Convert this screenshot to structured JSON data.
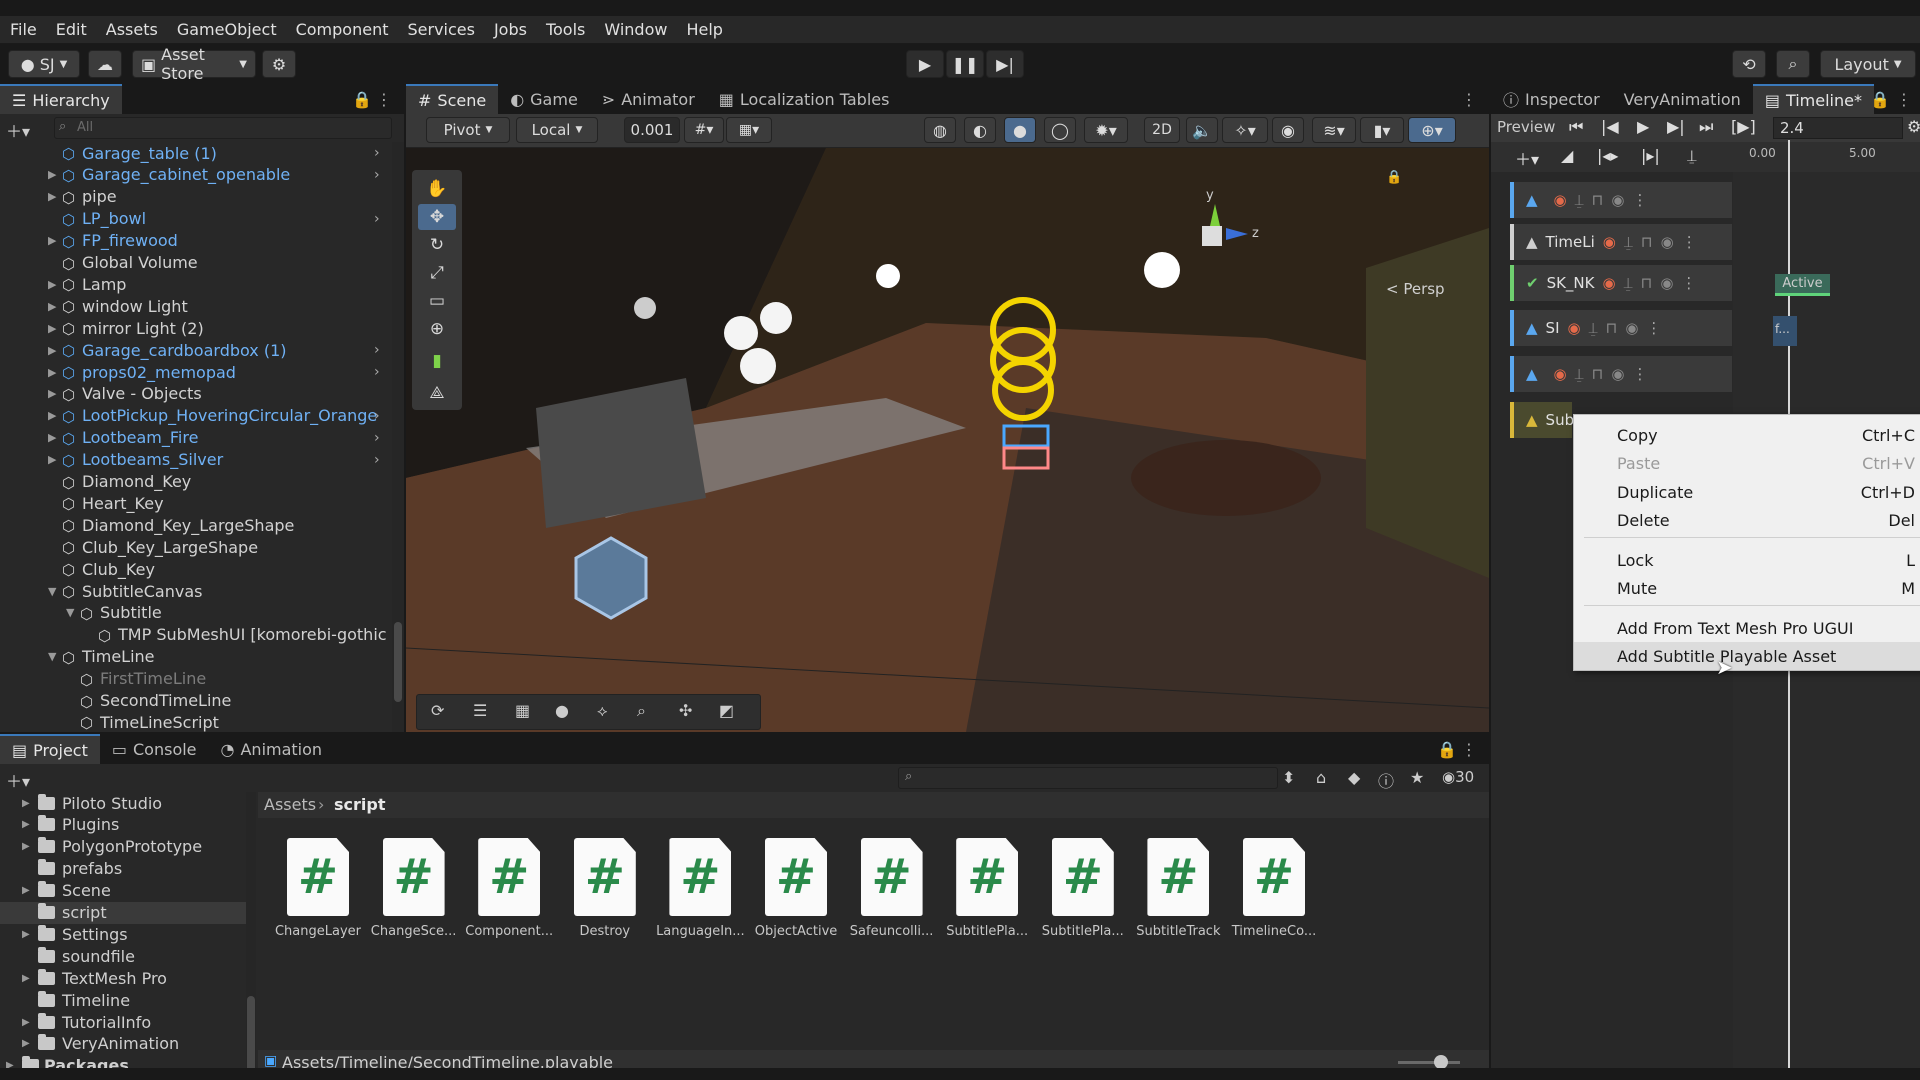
{
  "menu": [
    "File",
    "Edit",
    "Assets",
    "GameObject",
    "Component",
    "Services",
    "Jobs",
    "Tools",
    "Window",
    "Help"
  ],
  "toolbar": {
    "account": "SJ",
    "asset_store": "Asset Store",
    "layout": "Layout"
  },
  "hierarchy": {
    "title": "Hierarchy",
    "search_placeholder": "All",
    "items": [
      {
        "label": "Garage_table (1)",
        "blue": true,
        "indent": 0,
        "arrow": false,
        "expand": true
      },
      {
        "label": "Garage_cabinet_openable",
        "blue": true,
        "indent": 0,
        "arrow": true,
        "expand": true
      },
      {
        "label": "pipe",
        "blue": false,
        "indent": 0,
        "arrow": true,
        "expand": false
      },
      {
        "label": "LP_bowl",
        "blue": true,
        "indent": 0,
        "arrow": false,
        "expand": true
      },
      {
        "label": "FP_firewood",
        "blue": true,
        "indent": 0,
        "arrow": true,
        "expand": false
      },
      {
        "label": "Global Volume",
        "blue": false,
        "indent": 0,
        "arrow": false,
        "expand": false
      },
      {
        "label": "Lamp",
        "blue": false,
        "indent": 0,
        "arrow": true,
        "expand": false
      },
      {
        "label": "window Light",
        "blue": false,
        "indent": 0,
        "arrow": true,
        "expand": false
      },
      {
        "label": "mirror Light (2)",
        "blue": false,
        "indent": 0,
        "arrow": true,
        "expand": false
      },
      {
        "label": "Garage_cardboardbox (1)",
        "blue": true,
        "indent": 0,
        "arrow": true,
        "expand": true
      },
      {
        "label": "props02_memopad",
        "blue": true,
        "indent": 0,
        "arrow": true,
        "expand": true
      },
      {
        "label": "Valve - Objects",
        "blue": false,
        "indent": 0,
        "arrow": true,
        "expand": false
      },
      {
        "label": "LootPickup_HoveringCircular_Orange",
        "blue": true,
        "indent": 0,
        "arrow": true,
        "expand": true
      },
      {
        "label": "Lootbeam_Fire",
        "blue": true,
        "indent": 0,
        "arrow": true,
        "expand": true
      },
      {
        "label": "Lootbeams_Silver",
        "blue": true,
        "indent": 0,
        "arrow": true,
        "expand": true
      },
      {
        "label": "Diamond_Key",
        "blue": false,
        "indent": 0,
        "arrow": false,
        "expand": false
      },
      {
        "label": "Heart_Key",
        "blue": false,
        "indent": 0,
        "arrow": false,
        "expand": false
      },
      {
        "label": "Diamond_Key_LargeShape",
        "blue": false,
        "indent": 0,
        "arrow": false,
        "expand": false
      },
      {
        "label": "Club_Key_LargeShape",
        "blue": false,
        "indent": 0,
        "arrow": false,
        "expand": false
      },
      {
        "label": "Club_Key",
        "blue": false,
        "indent": 0,
        "arrow": false,
        "expand": false
      },
      {
        "label": "SubtitleCanvas",
        "blue": false,
        "indent": 0,
        "arrow": true,
        "open": true,
        "expand": false
      },
      {
        "label": "Subtitle",
        "blue": false,
        "indent": 1,
        "arrow": true,
        "open": true,
        "expand": false
      },
      {
        "label": "TMP SubMeshUI [komorebi-gothic S",
        "blue": false,
        "indent": 2,
        "arrow": false,
        "expand": false
      },
      {
        "label": "TimeLine",
        "blue": false,
        "indent": 0,
        "arrow": true,
        "open": true,
        "expand": false
      },
      {
        "label": "FirstTimeLine",
        "blue": false,
        "gray": true,
        "indent": 1,
        "arrow": false,
        "expand": false
      },
      {
        "label": "SecondTimeLine",
        "blue": false,
        "indent": 1,
        "arrow": false,
        "expand": false
      },
      {
        "label": "TimeLineScript",
        "blue": false,
        "indent": 1,
        "arrow": false,
        "expand": false
      }
    ]
  },
  "scene_tabs": [
    "Scene",
    "Game",
    "Animator",
    "Localization Tables"
  ],
  "scene_toolbar": {
    "pivot": "Pivot",
    "local": "Local",
    "snap": "0.001",
    "mode_2d": "2D"
  },
  "scene": {
    "persp_label": "< Persp",
    "gizmo_y": "y",
    "gizmo_z": "z"
  },
  "right_tabs": [
    "Inspector",
    "VeryAnimation",
    "Timeline*"
  ],
  "timeline": {
    "preview": "Preview",
    "frame": "2.4",
    "ruler": [
      "0.00",
      "5.00"
    ],
    "tracks": [
      {
        "label": ""
      },
      {
        "label": "TimeLi"
      },
      {
        "label": "SK_NK"
      },
      {
        "label": "SI"
      },
      {
        "label": ""
      },
      {
        "label": "Subt"
      }
    ],
    "active_clip": "Active",
    "clip_short": "f..."
  },
  "context_menu": {
    "items": [
      {
        "label": "Copy",
        "shortcut": "Ctrl+C",
        "disabled": false
      },
      {
        "label": "Paste",
        "shortcut": "Ctrl+V",
        "disabled": true
      },
      {
        "label": "Duplicate",
        "shortcut": "Ctrl+D",
        "disabled": false
      },
      {
        "label": "Delete",
        "shortcut": "Del",
        "disabled": false
      },
      {
        "label": "Lock",
        "shortcut": "L",
        "disabled": false
      },
      {
        "label": "Mute",
        "shortcut": "M",
        "disabled": false
      },
      {
        "label": "Add From Text Mesh Pro UGUI",
        "shortcut": "",
        "disabled": false
      },
      {
        "label": "Add Subtitle Playable Asset",
        "shortcut": "",
        "disabled": false
      }
    ]
  },
  "project": {
    "tabs": [
      "Project",
      "Console",
      "Animation"
    ],
    "hidden_count": "30",
    "breadcrumb": [
      "Assets",
      "script"
    ],
    "folders": [
      {
        "label": "Piloto Studio",
        "arrow": true
      },
      {
        "label": "Plugins",
        "arrow": true
      },
      {
        "label": "PolygonPrototype",
        "arrow": true
      },
      {
        "label": "prefabs",
        "arrow": false
      },
      {
        "label": "Scene",
        "arrow": true
      },
      {
        "label": "script",
        "arrow": false,
        "selected": true
      },
      {
        "label": "Settings",
        "arrow": true
      },
      {
        "label": "soundfile",
        "arrow": false
      },
      {
        "label": "TextMesh Pro",
        "arrow": true
      },
      {
        "label": "Timeline",
        "arrow": false
      },
      {
        "label": "TutorialInfo",
        "arrow": true
      },
      {
        "label": "VeryAnimation",
        "arrow": true
      }
    ],
    "packages": "Packages",
    "files": [
      "ChangeLayer",
      "ChangeSce...",
      "Component...",
      "Destroy",
      "LanguageIn...",
      "ObjectActive",
      "Safeuncolli...",
      "SubtitlePla...",
      "SubtitlePla...",
      "SubtitleTrack",
      "TimelineCo..."
    ],
    "status_path": "Assets/Timeline/SecondTimeline.playable"
  }
}
